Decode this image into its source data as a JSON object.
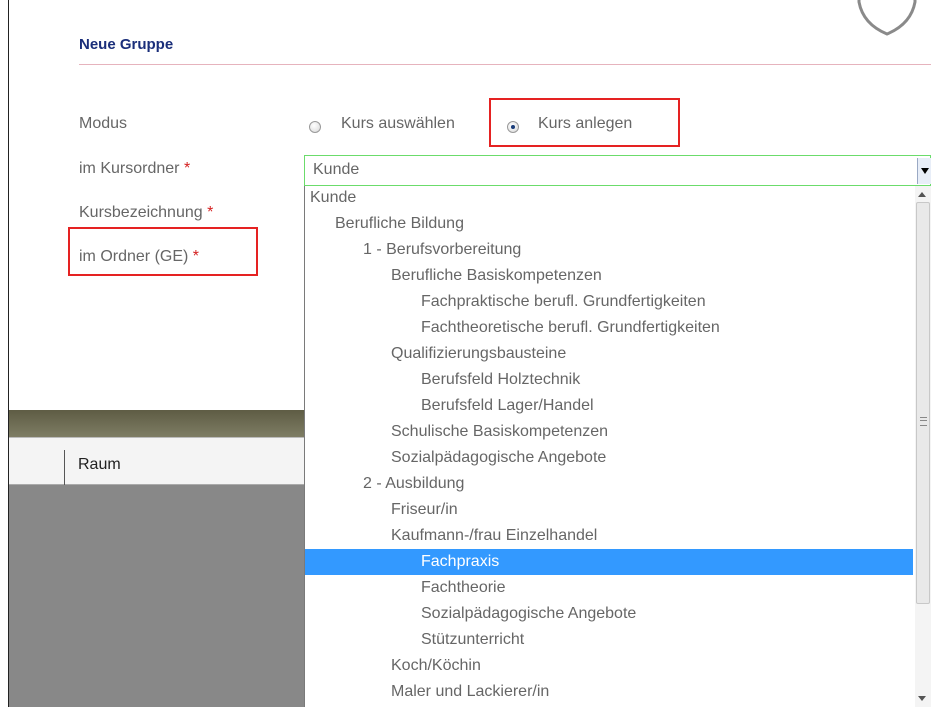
{
  "dialog": {
    "title": "Neue Gruppe"
  },
  "form": {
    "modus_label": "Modus",
    "kursordner_label": "im Kursordner",
    "kursbezeichnung_label": "Kursbezeichnung",
    "ordner_label": "im Ordner (GE)",
    "required_mark": "*",
    "radio_auswaehlen": "Kurs auswählen",
    "radio_anlegen": "Kurs anlegen",
    "radio_selected": "Kurs anlegen",
    "kursordner_value": "Kunde"
  },
  "grid": {
    "col_raum": "Raum"
  },
  "dropdown": {
    "items": [
      {
        "label": "Kunde",
        "level": 0
      },
      {
        "label": "Berufliche Bildung",
        "level": 1
      },
      {
        "label": "1 - Berufsvorbereitung",
        "level": 2
      },
      {
        "label": "Berufliche Basiskompetenzen",
        "level": 3
      },
      {
        "label": "Fachpraktische berufl. Grundfertigkeiten",
        "level": 4
      },
      {
        "label": "Fachtheoretische berufl. Grundfertigkeiten",
        "level": 4
      },
      {
        "label": "Qualifizierungsbausteine",
        "level": 3
      },
      {
        "label": "Berufsfeld Holztechnik",
        "level": 4
      },
      {
        "label": "Berufsfeld Lager/Handel",
        "level": 4
      },
      {
        "label": "Schulische Basiskompetenzen",
        "level": 3
      },
      {
        "label": "Sozialpädagogische Angebote",
        "level": 3
      },
      {
        "label": "2 - Ausbildung",
        "level": 2
      },
      {
        "label": "Friseur/in",
        "level": 3
      },
      {
        "label": "Kaufmann-/frau Einzelhandel",
        "level": 3
      },
      {
        "label": "Fachpraxis",
        "level": 4,
        "selected": true
      },
      {
        "label": "Fachtheorie",
        "level": 4
      },
      {
        "label": "Sozialpädagogische Angebote",
        "level": 4
      },
      {
        "label": "Stützunterricht",
        "level": 4
      },
      {
        "label": "Koch/Köchin",
        "level": 3
      },
      {
        "label": "Maler und Lackierer/in",
        "level": 3
      }
    ]
  },
  "colors": {
    "highlight_box": "#e52222",
    "selection": "#3399ff",
    "title": "#1a2e7a",
    "required": "#d42020"
  }
}
